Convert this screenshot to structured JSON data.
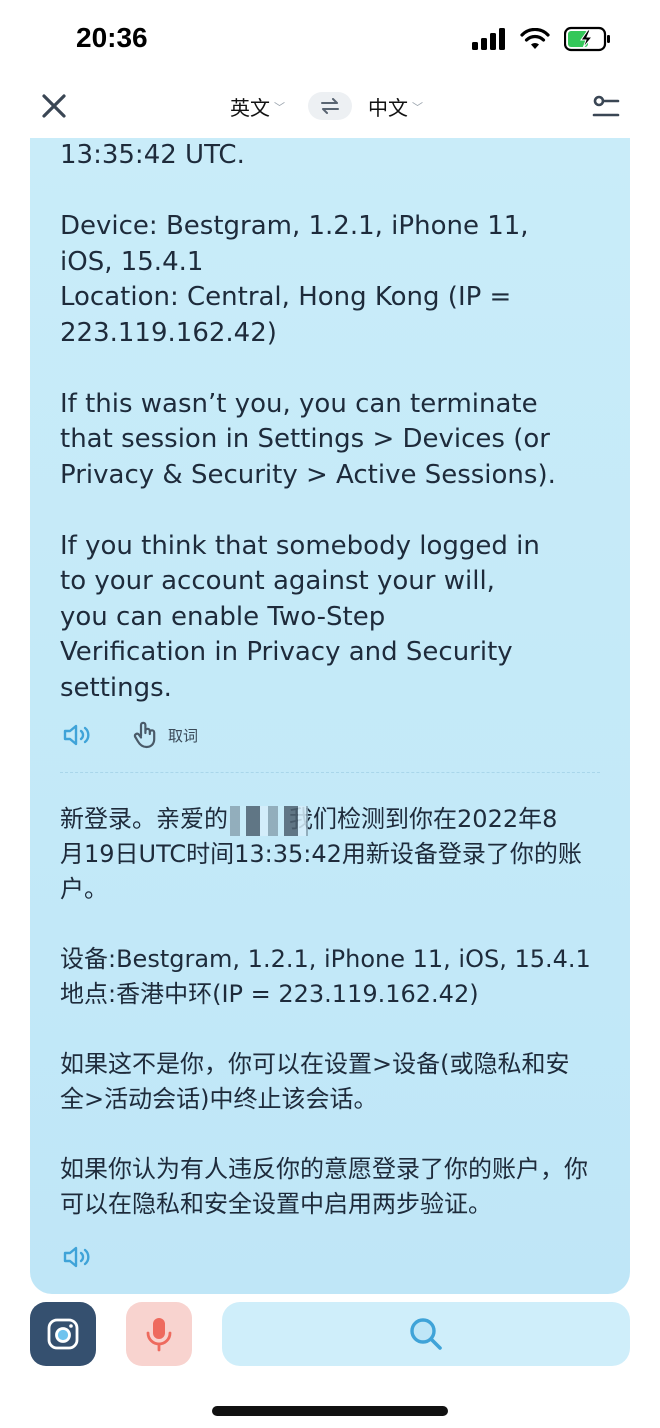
{
  "status_bar": {
    "time": "20:36"
  },
  "nav": {
    "source_lang": "英文",
    "target_lang": "中文"
  },
  "english_text": "13:35:42 UTC.\n\nDevice: Bestgram, 1.2.1, iPhone 11,\niOS, 15.4.1\nLocation: Central, Hong Kong (IP =\n223.119.162.42)\n\nIf this wasn’t you, you can terminate\nthat session in Settings > Devices (or\nPrivacy & Security > Active Sessions).\n\nIf you think that somebody logged in\nto your account against your will,\nyou can enable Two-Step\nVerification in Privacy and Security\nsettings.",
  "actions": {
    "pick_word_label": "取词"
  },
  "chinese_text": "新登录。亲爱的        我们检测到你在2022年8\n月19日UTC时间13:35:42用新设备登录了你的账\n户。\n\n设备:Bestgram, 1.2.1, iPhone 11, iOS, 15.4.1\n地点:香港中环(IP = 223.119.162.42)\n\n如果这不是你，你可以在设置>设备(或隐私和安\n全>活动会话)中终止该会话。\n\n如果你认为有人违反你的意愿登录了你的账户，你\n可以在隐私和安全设置中启用两步验证。",
  "icons": {
    "close": "close-icon",
    "swap": "swap-icon",
    "settings": "settings-icon",
    "speaker": "speaker-icon",
    "hand": "hand-pointer-icon",
    "camera": "camera-icon",
    "mic": "microphone-icon",
    "search": "search-icon"
  },
  "colors": {
    "card_bg": "#c9ecf9",
    "accent": "#3fa3d8",
    "camera_bg": "#35506f",
    "mic_bg": "#f8d3cf",
    "mic_icon": "#ee6a5e"
  }
}
